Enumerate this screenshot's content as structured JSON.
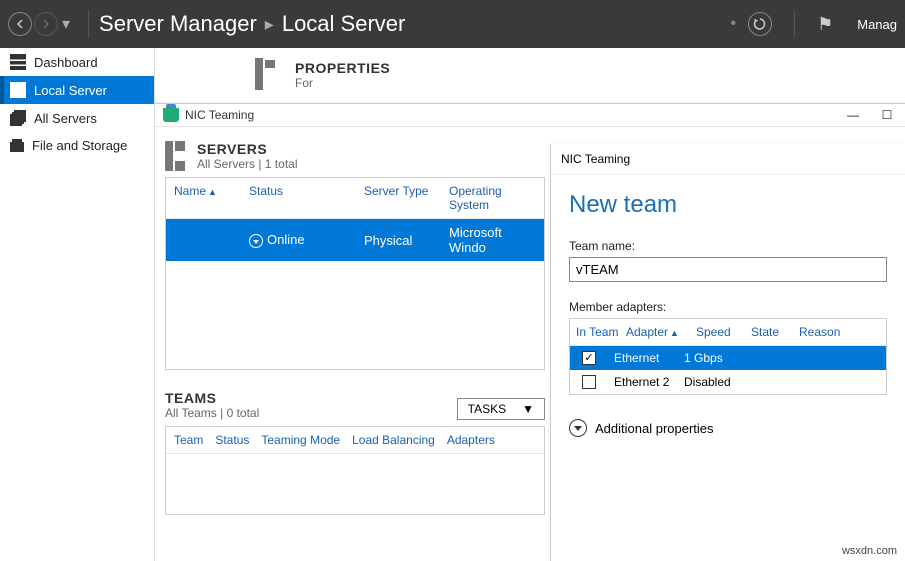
{
  "header": {
    "breadcrumb": [
      "Server Manager",
      "Local Server"
    ],
    "manage": "Manag"
  },
  "sidebar": {
    "items": [
      {
        "label": "Dashboard"
      },
      {
        "label": "Local Server"
      },
      {
        "label": "All Servers"
      },
      {
        "label": "File and Storage"
      }
    ]
  },
  "properties": {
    "title": "PROPERTIES",
    "for": "For"
  },
  "nic_window": {
    "title": "NIC Teaming"
  },
  "servers": {
    "title": "SERVERS",
    "subtitle": "All Servers | 1 total",
    "columns": {
      "name": "Name",
      "status": "Status",
      "type": "Server Type",
      "os": "Operating System"
    },
    "rows": [
      {
        "name": "",
        "status": "Online",
        "type": "Physical",
        "os": "Microsoft Windo"
      }
    ]
  },
  "teams": {
    "title": "TEAMS",
    "subtitle": "All Teams | 0 total",
    "tasks_label": "TASKS",
    "columns": {
      "team": "Team",
      "status": "Status",
      "mode": "Teaming Mode",
      "lb": "Load Balancing",
      "adapters": "Adapters"
    }
  },
  "dialog": {
    "bar_title": "NIC Teaming",
    "heading": "New team",
    "team_name_label": "Team name:",
    "team_name_value": "vTEAM",
    "member_label": "Member adapters:",
    "columns": {
      "inteam": "In Team",
      "adapter": "Adapter",
      "speed": "Speed",
      "state": "State",
      "reason": "Reason"
    },
    "adapters": [
      {
        "checked": true,
        "selected": true,
        "name": "Ethernet",
        "speed": "1 Gbps"
      },
      {
        "checked": false,
        "selected": false,
        "name": "Ethernet 2",
        "speed": "Disabled"
      }
    ],
    "additional": "Additional properties"
  },
  "watermark": "wsxdn.com"
}
